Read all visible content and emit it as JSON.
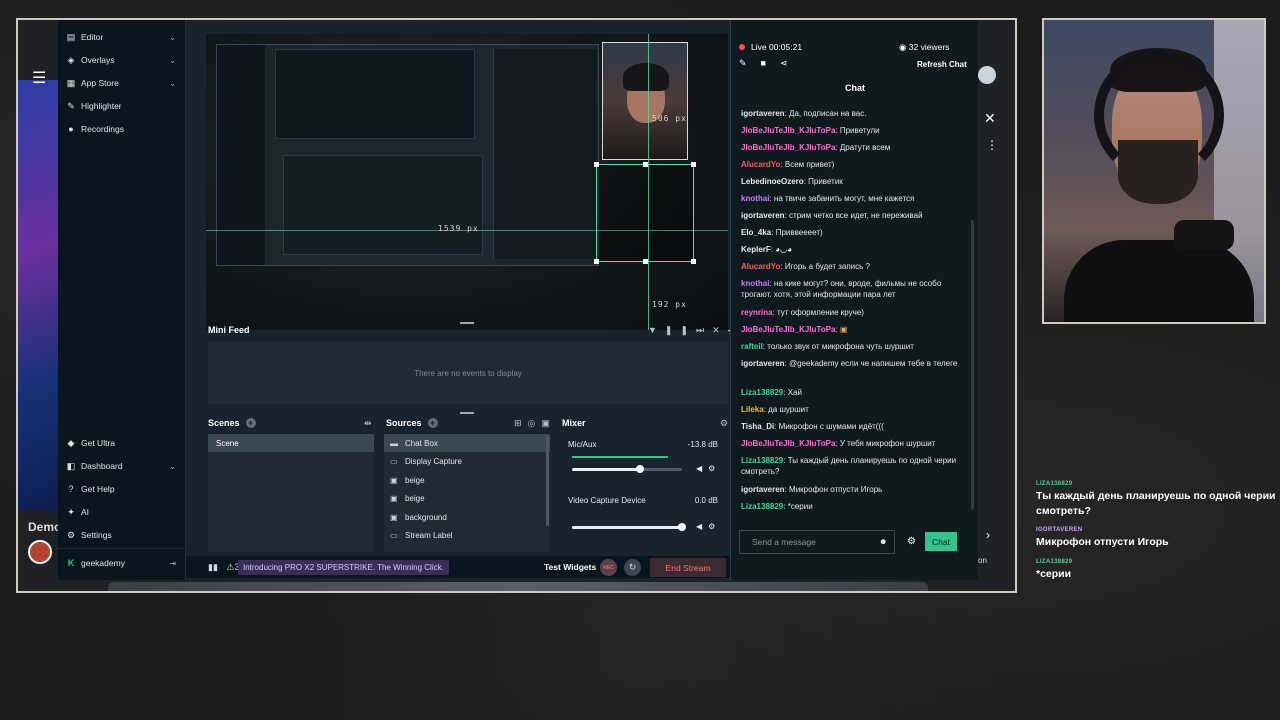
{
  "side_menu": {
    "items": [
      {
        "label": "Editor",
        "icon": "editor-icon",
        "chevron": true
      },
      {
        "label": "Overlays",
        "icon": "overlays-icon",
        "chevron": true
      },
      {
        "label": "App Store",
        "icon": "app-store-icon",
        "chevron": true
      },
      {
        "label": "Highlighter",
        "icon": "highlighter-icon",
        "chevron": false
      },
      {
        "label": "Recordings",
        "icon": "recordings-icon",
        "chevron": false
      }
    ],
    "bottom_items": [
      {
        "label": "Get Ultra",
        "icon": "ultra-icon"
      },
      {
        "label": "Dashboard",
        "icon": "dashboard-icon"
      },
      {
        "label": "Get Help",
        "icon": "help-icon"
      },
      {
        "label": "AI",
        "icon": "ai-icon"
      },
      {
        "label": "Settings",
        "icon": "settings-icon"
      }
    ],
    "account": "geekademy"
  },
  "preview": {
    "width_label": "1539 px",
    "top_label": "506 px",
    "bottom_label": "192 px"
  },
  "mini_feed": {
    "title": "Mini Feed",
    "empty_text": "There are no events to display"
  },
  "scenes": {
    "title": "Scenes",
    "items": [
      "Scene"
    ]
  },
  "sources": {
    "title": "Sources",
    "items": [
      {
        "label": "Chat Box",
        "icon": "chat-box-icon",
        "selected": true
      },
      {
        "label": "Display Capture",
        "icon": "display-icon",
        "selected": false
      },
      {
        "label": "beige",
        "icon": "image-icon",
        "selected": false
      },
      {
        "label": "beige",
        "icon": "image-icon",
        "selected": false
      },
      {
        "label": "background",
        "icon": "image-icon",
        "selected": false
      },
      {
        "label": "Stream Label",
        "icon": "label-icon",
        "selected": false
      }
    ]
  },
  "mixer": {
    "title": "Mixer",
    "channels": [
      {
        "name": "Mic/Aux",
        "db": "-13.8 dB",
        "level": 0.62
      },
      {
        "name": "Video Capture Device",
        "db": "0.0 dB",
        "level": 1.0
      }
    ]
  },
  "footer": {
    "alerts_count": "3",
    "promo": "Introducing PRO X2 SUPERSTRIKE. The Winning Click.",
    "test_widgets": "Test Widgets",
    "rec": "REC",
    "end_stream": "End Stream"
  },
  "left_browser": {
    "demo": "Demo"
  },
  "chat": {
    "live": "Live 00:05:21",
    "viewers": "32 viewers",
    "refresh": "Refresh Chat",
    "title": "Chat",
    "input_placeholder": "Send a message",
    "send": "Chat",
    "messages": [
      {
        "user": "igortaveren",
        "text": "Да, подписан на вас.",
        "color": "#e3e8eb"
      },
      {
        "user": "JIoBeJIuTeJIb_KJIuToPa",
        "text": "Приветули",
        "color": "#ff6fd0"
      },
      {
        "user": "JIoBeJIuTeJIb_KJIuToPa",
        "text": "Дратути всем",
        "color": "#ff6fd0"
      },
      {
        "user": "AlucardYo",
        "text": "Всем привет)",
        "color": "#ff5b5b"
      },
      {
        "user": "LebedinoeOzero",
        "text": "Приветик",
        "color": "#e3e8eb"
      },
      {
        "user": "knothai",
        "text": "на твиче забанить могут, мне кажется",
        "color": "#c77dff"
      },
      {
        "user": "igortaveren",
        "text": "стрим четко все идет, не переживай",
        "color": "#e3e8eb"
      },
      {
        "user": "Elo_4ka",
        "text": "Приввеееет)",
        "color": "#e3e8eb"
      },
      {
        "user": "KeplerF",
        "text": "",
        "color": "#e3e8eb"
      },
      {
        "user": "AlucardYo",
        "text": "Игорь а будет запись ?",
        "color": "#ff5b5b"
      },
      {
        "user": "knothai",
        "text": "на кике могут? они, вроде, фильмы не особо трогают. хотя, этой информации пара лет",
        "color": "#c77dff"
      },
      {
        "user": "reynrina",
        "text": "тут оформление круче)",
        "color": "#ff6fd0"
      },
      {
        "user": "JIoBeJIuTeJIb_KJIuToPa",
        "text": "",
        "color": "#ff6fd0"
      },
      {
        "user": "rafteil",
        "text": "только звук от микрофона чуть шуршит",
        "color": "#48d598"
      },
      {
        "user": "igortaveren",
        "text": "@geekademy если че напишем тебе в телеге",
        "color": "#e3e8eb"
      },
      {
        "user": "Liza138829",
        "text": "Хай",
        "color": "#48d598"
      },
      {
        "user": "Lileka",
        "text": "да шуршит",
        "color": "#ffb13b"
      },
      {
        "user": "Tisha_Di",
        "text": "Микрофон с шумами идёт(((",
        "color": "#e3e8eb"
      },
      {
        "user": "JIoBeJIuTeJIb_KJIuToPa",
        "text": "У тебя микрофон шуршит",
        "color": "#ff6fd0"
      },
      {
        "user": "Liza138829",
        "text": "Ты каждый день планируешь по одной черии смотреть?",
        "color": "#48d598"
      },
      {
        "user": "igortaveren",
        "text": "Микрофон отпусти Игорь",
        "color": "#e3e8eb"
      },
      {
        "user": "Liza138829",
        "text": "*серии",
        "color": "#48d598"
      }
    ]
  },
  "browser_right": {
    "on_text": "on"
  },
  "overlay_chat": [
    {
      "user": "LIZA138829",
      "text": "Ты каждый день планируешь по одной черии смотреть?"
    },
    {
      "user": "IGORTAVEREN",
      "text": "Микрофон отпусти Игорь"
    },
    {
      "user": "LIZA138829",
      "text": "*серии"
    }
  ],
  "colors": {
    "accent": "#31c48d",
    "app_bg": "#17242d",
    "sidebar_bg": "#09161d",
    "live": "#ff4c4c"
  }
}
